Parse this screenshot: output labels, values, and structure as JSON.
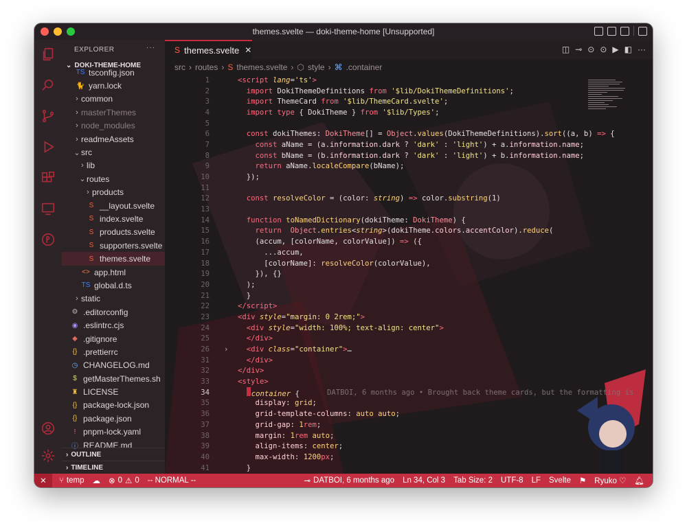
{
  "window": {
    "title": "themes.svelte — doki-theme-home [Unsupported]"
  },
  "explorer": {
    "header": "EXPLORER",
    "more": "···",
    "root": "DOKI-THEME-HOME",
    "items": [
      {
        "label": "tsconfig.json",
        "indent": 1,
        "icon": "tsconfig-icon",
        "kind": "file"
      },
      {
        "label": "yarn.lock",
        "indent": 1,
        "icon": "yarn-icon",
        "kind": "file"
      },
      {
        "label": "common",
        "indent": 1,
        "icon": "",
        "kind": "folder"
      },
      {
        "label": "masterThemes",
        "indent": 1,
        "icon": "",
        "kind": "folder",
        "dim": true
      },
      {
        "label": "node_modules",
        "indent": 1,
        "icon": "",
        "kind": "folder",
        "dim": true
      },
      {
        "label": "readmeAssets",
        "indent": 1,
        "icon": "",
        "kind": "folder"
      },
      {
        "label": "src",
        "indent": 1,
        "icon": "",
        "kind": "folder-open"
      },
      {
        "label": "lib",
        "indent": 2,
        "icon": "",
        "kind": "folder"
      },
      {
        "label": "routes",
        "indent": 2,
        "icon": "",
        "kind": "folder-open"
      },
      {
        "label": "products",
        "indent": 3,
        "icon": "",
        "kind": "folder"
      },
      {
        "label": "__layout.svelte",
        "indent": 3,
        "icon": "svelte-icon",
        "kind": "file"
      },
      {
        "label": "index.svelte",
        "indent": 3,
        "icon": "svelte-icon",
        "kind": "file"
      },
      {
        "label": "products.svelte",
        "indent": 3,
        "icon": "svelte-icon",
        "kind": "file"
      },
      {
        "label": "supporters.svelte",
        "indent": 3,
        "icon": "svelte-icon",
        "kind": "file"
      },
      {
        "label": "themes.svelte",
        "indent": 3,
        "icon": "svelte-icon",
        "kind": "file"
      },
      {
        "label": "app.html",
        "indent": 2,
        "icon": "html-icon",
        "kind": "file"
      },
      {
        "label": "global.d.ts",
        "indent": 2,
        "icon": "typescript-icon",
        "kind": "file"
      },
      {
        "label": "static",
        "indent": 1,
        "icon": "",
        "kind": "folder"
      },
      {
        "label": ".editorconfig",
        "indent": 0,
        "icon": "gear-icon",
        "kind": "file"
      },
      {
        "label": ".eslintrc.cjs",
        "indent": 0,
        "icon": "eslint-icon",
        "kind": "file"
      },
      {
        "label": ".gitignore",
        "indent": 0,
        "icon": "git-icon",
        "kind": "file"
      },
      {
        "label": ".prettierrc",
        "indent": 0,
        "icon": "json-icon",
        "kind": "file"
      },
      {
        "label": "CHANGELOG.md",
        "indent": 0,
        "icon": "clock-icon",
        "kind": "file"
      },
      {
        "label": "getMasterThemes.sh",
        "indent": 0,
        "icon": "shell-icon",
        "kind": "file"
      },
      {
        "label": "LICENSE",
        "indent": 0,
        "icon": "license-icon",
        "kind": "file"
      },
      {
        "label": "package-lock.json",
        "indent": 0,
        "icon": "json-icon",
        "kind": "file"
      },
      {
        "label": "package.json",
        "indent": 0,
        "icon": "json-icon",
        "kind": "file"
      },
      {
        "label": "pnpm-lock.yaml",
        "indent": 0,
        "icon": "yaml-icon",
        "kind": "file"
      },
      {
        "label": "README.md",
        "indent": 0,
        "icon": "info-icon",
        "kind": "file"
      }
    ],
    "outline": "OUTLINE",
    "timeline": "TIMELINE"
  },
  "icon_glyphs": {
    "tsconfig-icon": "TS",
    "yarn-icon": "🐈",
    "svelte-icon": "S",
    "html-icon": "<>",
    "typescript-icon": "TS",
    "gear-icon": "⚙",
    "eslint-icon": "◉",
    "git-icon": "◆",
    "json-icon": "{}",
    "clock-icon": "◷",
    "shell-icon": "$",
    "license-icon": "♜",
    "yaml-icon": "!",
    "info-icon": "ⓘ"
  },
  "icon_colors": {
    "tsconfig-icon": "#3b82f6",
    "yarn-icon": "#4aa3df",
    "svelte-icon": "#ff5e3a",
    "html-icon": "#ff7a45",
    "typescript-icon": "#3b82f6",
    "gear-icon": "#bdb6b9",
    "eslint-icon": "#a78bfa",
    "git-icon": "#e0685f",
    "json-icon": "#f5c542",
    "clock-icon": "#6aa9ff",
    "shell-icon": "#c8e25a",
    "license-icon": "#f5c542",
    "yaml-icon": "#ff5e8a",
    "info-icon": "#6aa9ff"
  },
  "tab": {
    "label": "themes.svelte",
    "close": "✕"
  },
  "breadcrumbs": [
    "src",
    "routes",
    "themes.svelte",
    "style",
    ".container"
  ],
  "code_lines": [
    {
      "n": "1",
      "html": "<span class='tag'>&lt;script</span> <span class='it'>lang</span><span class='pl'>=</span><span class='str'>'ts'</span><span class='tag'>&gt;</span>"
    },
    {
      "n": "2",
      "html": "  <span class='kw'>import</span> DokiThemeDefinitions <span class='kw'>from</span> <span class='str'>'$lib/DokiThemeDefinitions'</span>;"
    },
    {
      "n": "3",
      "html": "  <span class='kw'>import</span> ThemeCard <span class='kw'>from</span> <span class='str'>'$lib/ThemeCard.svelte'</span>;"
    },
    {
      "n": "4",
      "html": "  <span class='kw'>import type</span> { DokiTheme } <span class='kw'>from</span> <span class='str'>'$lib/Types'</span>;"
    },
    {
      "n": "5",
      "html": ""
    },
    {
      "n": "6",
      "html": "  <span class='kw'>const</span> dokiThemes: <span class='ty'>DokiTheme</span>[] = <span class='ty'>Object</span>.<span class='fn'>values</span>(DokiThemeDefinitions).<span class='fn'>sort</span>((a, b) <span class='kw'>=&gt;</span> {"
    },
    {
      "n": "7",
      "html": "    <span class='kw'>const</span> aName = (a.<span class='prop'>information</span>.<span class='prop'>dark</span> ? <span class='str'>'dark'</span> : <span class='str'>'light'</span>) + a.<span class='prop'>information</span>.<span class='prop'>name</span>;"
    },
    {
      "n": "8",
      "html": "    <span class='kw'>const</span> bName = (b.<span class='prop'>information</span>.<span class='prop'>dark</span> ? <span class='str'>'dark'</span> : <span class='str'>'light'</span>) + b.<span class='prop'>information</span>.<span class='prop'>name</span>;"
    },
    {
      "n": "9",
      "html": "    <span class='kw'>return</span> aName.<span class='fn'>localeCompare</span>(bName);"
    },
    {
      "n": "10",
      "html": "  });"
    },
    {
      "n": "11",
      "html": ""
    },
    {
      "n": "12",
      "html": "  <span class='kw'>const</span> <span class='fn'>resolveColor</span> = (color: <span class='it'>string</span>) <span class='kw'>=&gt;</span> color.<span class='fn'>substring</span>(1)"
    },
    {
      "n": "13",
      "html": ""
    },
    {
      "n": "14",
      "html": "  <span class='kw'>function</span> <span class='fn'>toNamedDictionary</span>(dokiTheme: <span class='ty'>DokiTheme</span>) {"
    },
    {
      "n": "15",
      "html": "    <span class='kw'>return</span>  <span class='ty'>Object</span>.<span class='fn'>entries</span>&lt;<span class='it'>string</span>&gt;(dokiTheme.<span class='prop'>colors</span>.<span class='prop'>accentColor</span>).<span class='fn'>reduce</span>("
    },
    {
      "n": "16",
      "html": "    (accum, [colorName, colorValue]) <span class='kw'>=&gt;</span> ({"
    },
    {
      "n": "17",
      "html": "      ...accum,"
    },
    {
      "n": "18",
      "html": "      [colorName]: <span class='fn'>resolveColor</span>(colorValue),"
    },
    {
      "n": "19",
      "html": "    }), {}"
    },
    {
      "n": "20",
      "html": "  );"
    },
    {
      "n": "21",
      "html": "  }"
    },
    {
      "n": "22",
      "html": "<span class='tag'>&lt;/script&gt;</span>"
    },
    {
      "n": "23",
      "html": "<span class='tag'>&lt;div</span> <span class='it'>style</span>=<span class='str'>\"margin: 0 2rem;\"</span><span class='tag'>&gt;</span>"
    },
    {
      "n": "24",
      "html": "  <span class='tag'>&lt;div</span> <span class='it'>style</span>=<span class='str'>\"width: 100%; text-align: center\"</span><span class='tag'>&gt;</span>"
    },
    {
      "n": "25",
      "html": "  <span class='tag'>&lt;/div&gt;</span>"
    },
    {
      "n": "26",
      "html": "  <span class='tag'>&lt;div</span> <span class='it'>class</span>=<span class='str'>\"container\"</span><span class='tag'>&gt;</span>…",
      "fold": "›"
    },
    {
      "n": "31",
      "html": "  <span class='tag'>&lt;/div&gt;</span>"
    },
    {
      "n": "32",
      "html": "<span class='tag'>&lt;/div&gt;</span>"
    },
    {
      "n": "33",
      "html": "<span class='tag'>&lt;style&gt;</span>"
    },
    {
      "n": "34",
      "html": "  <span class='cursor-mark'></span><span class='it'>container</span> {",
      "cur": true,
      "blame": "DATBOI, 6 months ago • Brought back theme cards, but the formatting is"
    },
    {
      "n": "35",
      "html": "    <span class='prop'>display</span>: <span class='fn'>grid</span>;"
    },
    {
      "n": "36",
      "html": "    <span class='prop'>grid-template-columns</span>: <span class='fn'>auto auto</span>;"
    },
    {
      "n": "37",
      "html": "    <span class='prop'>grid-gap</span>: <span class='fn'>1</span><span class='kw'>rem</span>;"
    },
    {
      "n": "38",
      "html": "    <span class='prop'>margin</span>: <span class='fn'>1</span><span class='kw'>rem</span> <span class='fn'>auto</span>;"
    },
    {
      "n": "39",
      "html": "    <span class='prop'>align-items</span>: <span class='fn'>center</span>;"
    },
    {
      "n": "40",
      "html": "    <span class='prop'>max-width</span>: <span class='fn'>1200</span><span class='kw'>px</span>;"
    },
    {
      "n": "41",
      "html": "  }"
    }
  ],
  "status": {
    "branch": "temp",
    "errors": "0",
    "warnings": "0",
    "mode": "-- NORMAL --",
    "blame": "DATBOI, 6 months ago",
    "position": "Ln 34, Col 3",
    "tab_size": "Tab Size: 2",
    "encoding": "UTF-8",
    "eol": "LF",
    "language": "Svelte",
    "theme": "Ryuko ♡"
  },
  "colors": {
    "accent": "#c62f41",
    "background": "#1f1b1d",
    "sidebar": "#2b2326"
  }
}
